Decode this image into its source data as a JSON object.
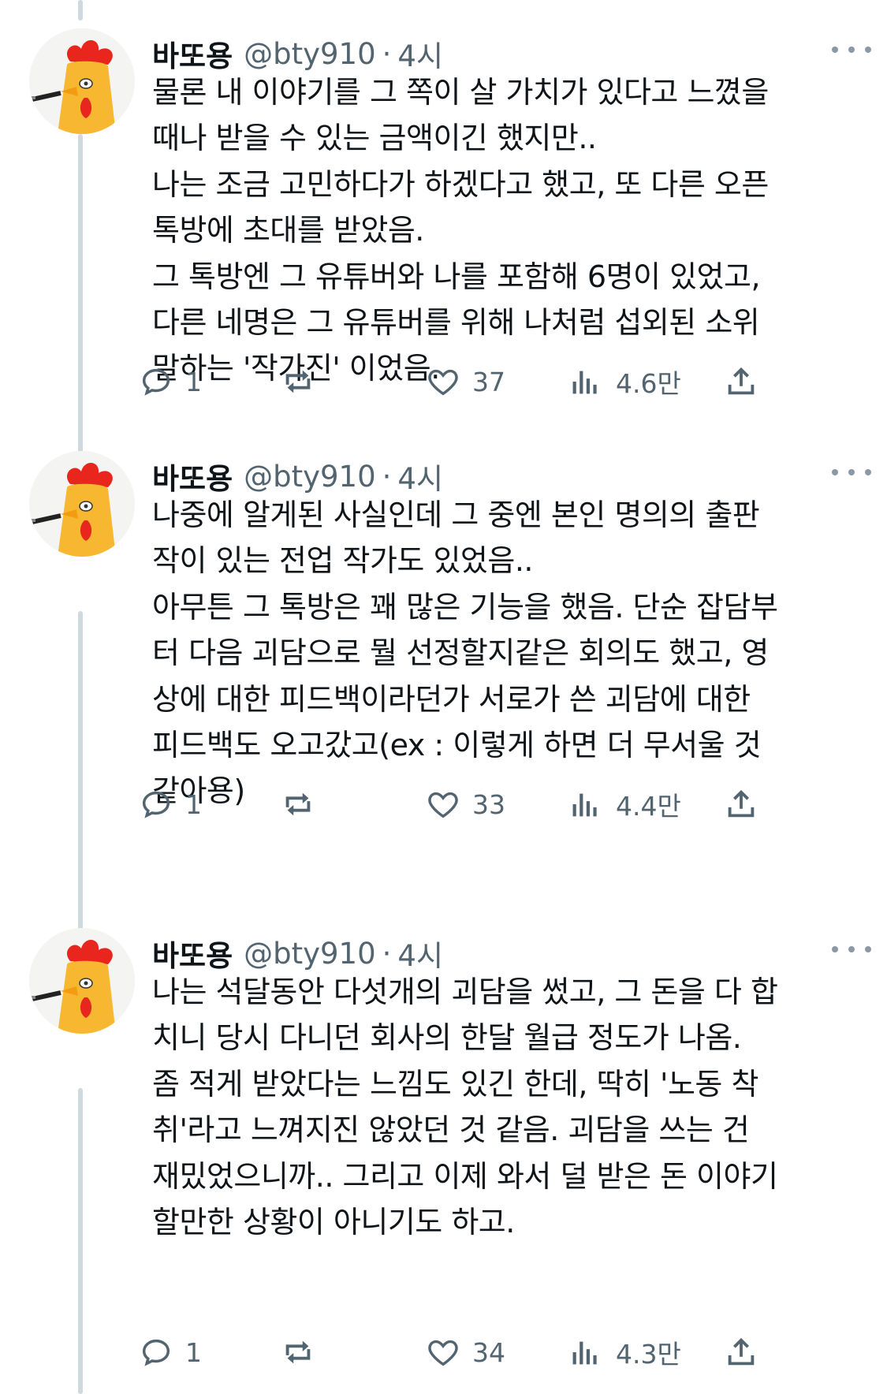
{
  "tweets": [
    {
      "author": {
        "name": "바또용",
        "handle": "@bty910",
        "time": "4시"
      },
      "separator": "·",
      "body": "물론 내 이야기를 그 쪽이 살 가치가 있다고 느꼈을\n때나 받을 수 있는 금액이긴 했지만..\n나는 조금 고민하다가 하겠다고 했고, 또 다른 오픈\n톡방에 초대를 받았음.\n그 톡방엔 그 유튜버와 나를 포함해 6명이 있었고,\n다른 네명은 그 유튜버를 위해 나처럼 섭외된 소위\n말하는 '작가진' 이었음.",
      "stats": {
        "replies": "1",
        "retweets": "",
        "likes": "37",
        "views": "4.6만"
      }
    },
    {
      "author": {
        "name": "바또용",
        "handle": "@bty910",
        "time": "4시"
      },
      "separator": "·",
      "body": "나중에 알게된 사실인데 그 중엔 본인 명의의 출판\n작이 있는 전업 작가도 있었음..\n아무튼 그 톡방은 꽤 많은 기능을 했음. 단순 잡담부\n터 다음 괴담으로 뭘 선정할지같은 회의도 했고, 영\n상에 대한 피드백이라던가 서로가 쓴 괴담에 대한\n피드백도 오고갔고(ex : 이렇게 하면 더 무서울 것\n같아용)",
      "stats": {
        "replies": "1",
        "retweets": "",
        "likes": "33",
        "views": "4.4만"
      }
    },
    {
      "author": {
        "name": "바또용",
        "handle": "@bty910",
        "time": "4시"
      },
      "separator": "·",
      "body": "나는 석달동안 다섯개의 괴담을 썼고, 그 돈을 다 합\n치니 당시 다니던 회사의 한달 월급 정도가 나옴.\n좀 적게 받았다는 느낌도 있긴 한데, 딱히 '노동 착\n취'라고 느껴지진 않았던 것 같음. 괴담을 쓰는 건\n재밌었으니까.. 그리고 이제 와서 덜 받은 돈 이야기\n할만한 상황이 아니기도 하고.",
      "stats": {
        "replies": "1",
        "retweets": "",
        "likes": "34",
        "views": "4.3만"
      }
    }
  ],
  "icons": {
    "reply": "reply-icon",
    "retweet": "retweet-icon",
    "like": "heart-icon",
    "views": "views-icon",
    "share": "share-icon",
    "more": "more-icon"
  },
  "colors": {
    "text": "#0f1419",
    "secondary": "#536471",
    "thread_line": "#cfd9de"
  }
}
